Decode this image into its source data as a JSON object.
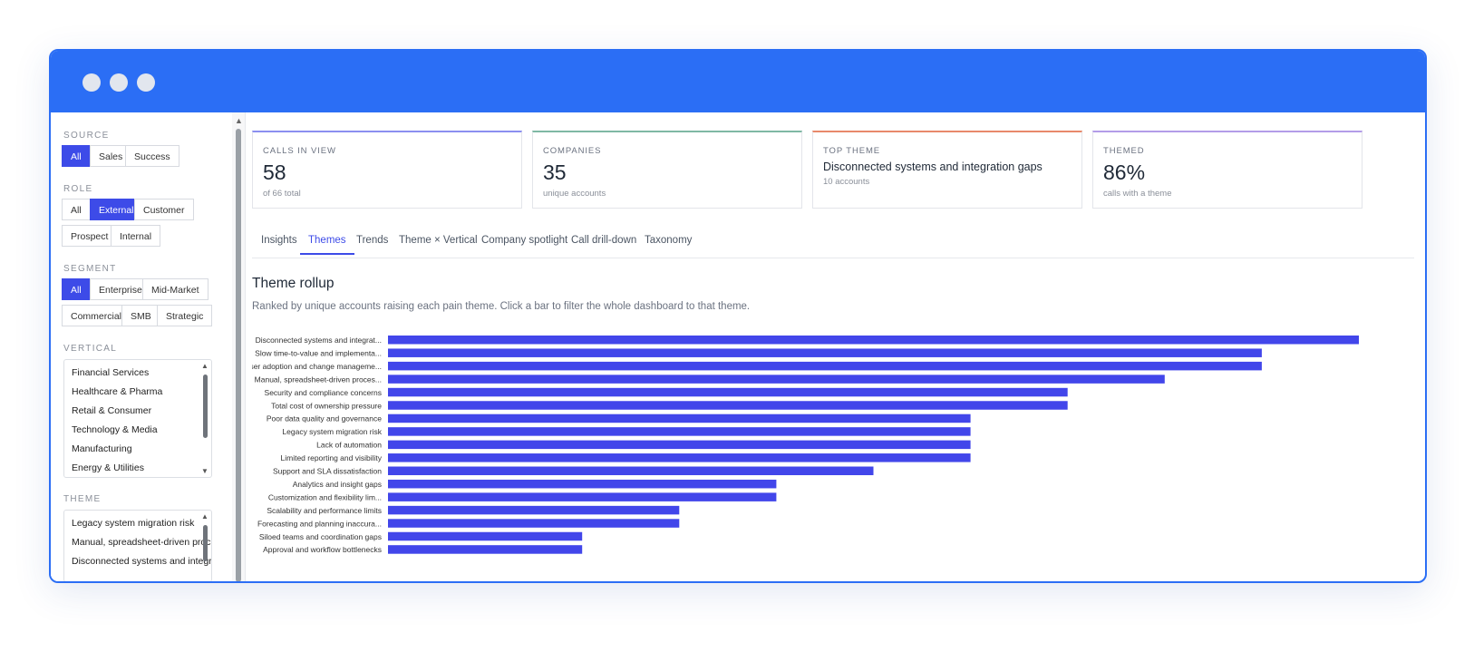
{
  "colors": {
    "accent": "#3d4be8",
    "titlebar": "#2b6ef5",
    "bar": "#4246ea"
  },
  "sidebar": {
    "source": {
      "label": "SOURCE",
      "options": [
        "All",
        "Sales",
        "Success"
      ],
      "active": "All"
    },
    "role": {
      "label": "ROLE",
      "options": [
        "All",
        "External",
        "Customer",
        "Prospect",
        "Internal"
      ],
      "active": "External"
    },
    "segment": {
      "label": "SEGMENT",
      "options": [
        "All",
        "Enterprise",
        "Mid-Market",
        "Commercial",
        "SMB",
        "Strategic"
      ],
      "active": "All"
    },
    "vertical": {
      "label": "VERTICAL",
      "items": [
        "Financial Services",
        "Healthcare & Pharma",
        "Retail & Consumer",
        "Technology & Media",
        "Manufacturing",
        "Energy & Utilities"
      ]
    },
    "theme": {
      "label": "THEME",
      "items": [
        "Legacy system migration risk",
        "Manual, spreadsheet-driven processe",
        "Disconnected systems and integratior"
      ]
    }
  },
  "cards": [
    {
      "label": "CALLS IN VIEW",
      "value": "58",
      "sub": "of 66 total",
      "accent": "#8b8ff0"
    },
    {
      "label": "COMPANIES",
      "value": "35",
      "sub": "unique accounts",
      "accent": "#7fb8a4"
    },
    {
      "label": "TOP THEME",
      "value": "Disconnected systems and integration gaps",
      "sub": "10 accounts",
      "accent": "#e8896b"
    },
    {
      "label": "THEMED",
      "value": "86%",
      "sub": "calls with a theme",
      "accent": "#b39ce8"
    }
  ],
  "tabs": [
    "Insights",
    "Themes",
    "Trends",
    "Theme × Vertical",
    "Company spotlight",
    "Call drill-down",
    "Taxonomy"
  ],
  "active_tab": "Themes",
  "section": {
    "title": "Theme rollup",
    "description": "Ranked by unique accounts raising each pain theme. Click a bar to filter the whole dashboard to that theme."
  },
  "chart_data": {
    "type": "bar",
    "orientation": "horizontal",
    "categories": [
      "Disconnected systems and integrat...",
      "Slow time-to-value and implementa...",
      "User adoption and change manageme...",
      "Manual, spreadsheet-driven proces...",
      "Security and compliance concerns",
      "Total cost of ownership pressure",
      "Poor data quality and governance",
      "Legacy system migration risk",
      "Lack of automation",
      "Limited reporting and visibility",
      "Support and SLA dissatisfaction",
      "Analytics and insight gaps",
      "Customization and flexibility lim...",
      "Scalability and performance limits",
      "Forecasting and planning inaccura...",
      "Siloed teams and coordination gaps",
      "Approval and workflow bottlenecks"
    ],
    "values": [
      10,
      9,
      9,
      8,
      7,
      7,
      6,
      6,
      6,
      6,
      5,
      4,
      4,
      3,
      3,
      2,
      2
    ],
    "xlim": [
      0,
      10
    ],
    "grid": false
  }
}
